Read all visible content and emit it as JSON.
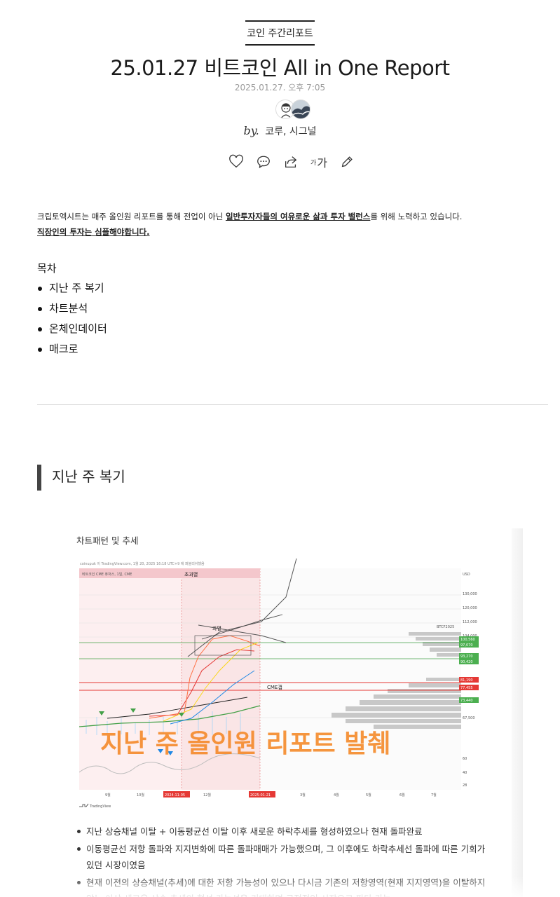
{
  "post": {
    "category": "코인 주간리포트",
    "title": "25.01.27 비트코인 All in One Report",
    "date": "2025.01.27. 오후 7:05",
    "by_prefix": "by.",
    "authors": "코루, 시그널"
  },
  "actions": {
    "icons": [
      "heart-icon",
      "comment-icon",
      "share-icon",
      "font-size-icon",
      "pencil-icon"
    ],
    "font_small": "가",
    "font_big": "가"
  },
  "intro": {
    "part1": "크립토엑시트는 매주 올인원 리포트를 통해 전업이 아닌 ",
    "highlight": "일반투자자들의 여유로운 삶과 투자 밸런스",
    "part2": "를 위해 노력하고 있습니다.",
    "line2": "직장인의 투자는 심플해야합니다."
  },
  "toc": {
    "title": "목차",
    "items": [
      "지난 주 복기",
      "차트분석",
      "온체인데이터",
      "매크로"
    ]
  },
  "section": {
    "heading": "지난 주 복기"
  },
  "card": {
    "title": "차트패턴 및 추세",
    "bullets": [
      "지난 상승채널 이탈 + 이동평균선 이탈 이후 새로운 하락추세를 형성하였으나 현재 돌파완료",
      "이동평균선 저항 돌파와 지지변화에 따른 돌파매매가 가능했으며, 그 이후에도 하락추세선 돌파에 따른 기회가 있던 시장이였음",
      "현재 이전의 상승채널(추세)에 대한 저항 가능성이 있으나 다시금 기존의 저항영역(현재 지지영역)을 이탈하지 않는 이상 새로운 상승 추세의 형성 가능성을 기대하며 긍정적인 시장으로 판단 가능"
    ]
  },
  "chart": {
    "header": "coinupuk 이 TradingView.com, 1월 20, 2025 16:18 UTC+9 에 퍼블리쉬했음",
    "symbol_line": "비트코인 CME 퓨처스, 1일, CME",
    "watermark": "지난 주 올인원 리포트 발췌",
    "labels": {
      "box": "과열",
      "cme_gap": "CME갭",
      "overheat": "초과열",
      "ticker": "BTCF2025",
      "logo": "TradingView"
    },
    "y_ticks": [
      "USD",
      "130,000",
      "120,000",
      "112,000",
      "104,000",
      "67,500",
      "60",
      "40",
      "28"
    ],
    "price_tags": [
      {
        "text": "100,560",
        "color": "#4caf50"
      },
      {
        "text": "97,070",
        "color": "#4caf50"
      },
      {
        "text": "93,270",
        "color": "#4caf50"
      },
      {
        "text": "90,420",
        "color": "#4caf50"
      },
      {
        "text": "81,190",
        "color": "#e53935"
      },
      {
        "text": "77,455",
        "color": "#e53935"
      },
      {
        "text": "73,440",
        "color": "#4caf50"
      }
    ],
    "x_ticks": [
      "9월",
      "10월",
      "2024-11-05",
      "12월",
      "2025-01-21",
      "3월",
      "4월",
      "5월",
      "6월",
      "7월"
    ]
  }
}
